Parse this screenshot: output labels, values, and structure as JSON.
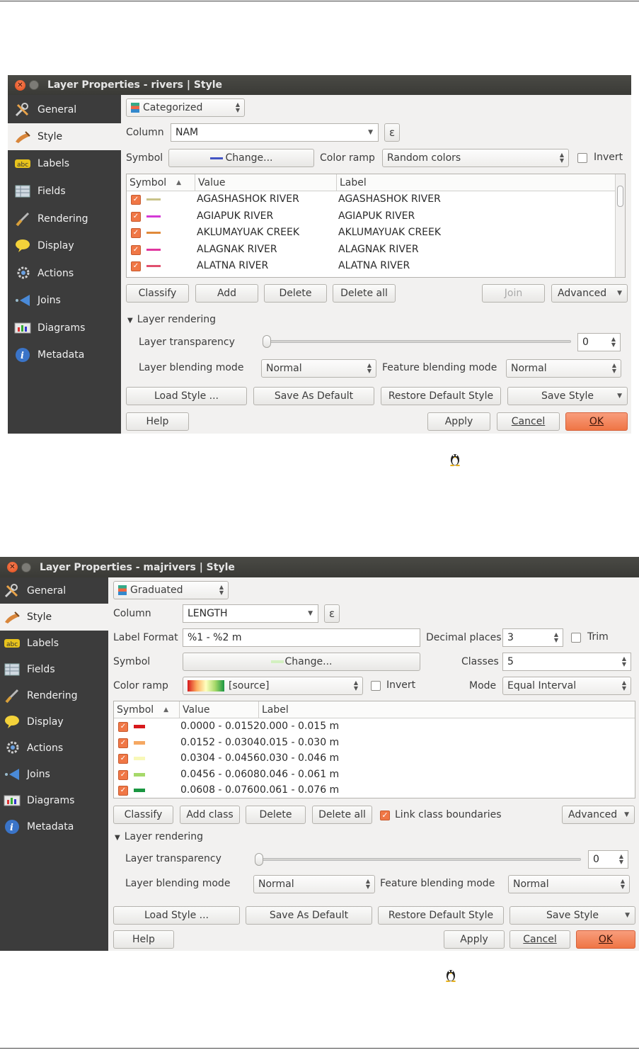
{
  "dialog1": {
    "title": "Layer Properties - rivers | Style",
    "sidebar": [
      "General",
      "Style",
      "Labels",
      "Fields",
      "Rendering",
      "Display",
      "Actions",
      "Joins",
      "Diagrams",
      "Metadata"
    ],
    "renderer": "Categorized",
    "column_label": "Column",
    "column_value": "NAM",
    "symbol_label": "Symbol",
    "change_label": "Change...",
    "color_ramp_label": "Color ramp",
    "color_ramp_value": "Random colors",
    "invert_label": "Invert",
    "headers": [
      "Symbol",
      "Value",
      "Label"
    ],
    "rows": [
      {
        "value": "AGASHASHOK RIVER",
        "label": "AGASHASHOK RIVER",
        "color": "#c9c38a"
      },
      {
        "value": "AGIAPUK RIVER",
        "label": "AGIAPUK RIVER",
        "color": "#d33ad6"
      },
      {
        "value": "AKLUMAYUAK CREEK",
        "label": "AKLUMAYUAK CREEK",
        "color": "#e08a3a"
      },
      {
        "value": "ALAGNAK RIVER",
        "label": "ALAGNAK RIVER",
        "color": "#e0379e"
      },
      {
        "value": "ALATNA RIVER",
        "label": "ALATNA RIVER",
        "color": "#e0506e"
      }
    ],
    "buttons": {
      "classify": "Classify",
      "add": "Add",
      "delete": "Delete",
      "delete_all": "Delete all",
      "join": "Join",
      "advanced": "Advanced"
    },
    "layer_rendering": "Layer rendering",
    "transparency_label": "Layer transparency",
    "transparency_value": "0",
    "blending_label": "Layer blending mode",
    "blending_value": "Normal",
    "feature_blending_label": "Feature blending mode",
    "feature_blending_value": "Normal",
    "style_buttons": {
      "load": "Load Style ...",
      "save_default": "Save As Default",
      "restore": "Restore Default Style",
      "save": "Save Style"
    },
    "footer": {
      "help": "Help",
      "apply": "Apply",
      "cancel": "Cancel",
      "ok": "OK"
    }
  },
  "dialog2": {
    "title": "Layer Properties - majrivers | Style",
    "sidebar": [
      "General",
      "Style",
      "Labels",
      "Fields",
      "Rendering",
      "Display",
      "Actions",
      "Joins",
      "Diagrams",
      "Metadata"
    ],
    "renderer": "Graduated",
    "column_label": "Column",
    "column_value": "LENGTH",
    "label_format_label": "Label Format",
    "label_format_value": "%1 - %2 m",
    "decimal_places_label": "Decimal places",
    "decimal_places_value": "3",
    "trim_label": "Trim",
    "symbol_label": "Symbol",
    "change_label": "Change...",
    "classes_label": "Classes",
    "classes_value": "5",
    "color_ramp_label": "Color ramp",
    "color_ramp_value": "[source]",
    "invert_label": "Invert",
    "mode_label": "Mode",
    "mode_value": "Equal Interval",
    "headers": [
      "Symbol",
      "Value",
      "Label"
    ],
    "rows": [
      {
        "value": "0.0000 - 0.0152",
        "label": "0.000 - 0.015 m",
        "color": "#d7191c"
      },
      {
        "value": "0.0152 - 0.0304",
        "label": "0.015 - 0.030 m",
        "color": "#f5a862"
      },
      {
        "value": "0.0304 - 0.0456",
        "label": "0.030 - 0.046 m",
        "color": "#f8f8b8"
      },
      {
        "value": "0.0456 - 0.0608",
        "label": "0.046 - 0.061 m",
        "color": "#a6d96a"
      },
      {
        "value": "0.0608 - 0.0760",
        "label": "0.061 - 0.076 m",
        "color": "#1a9641"
      }
    ],
    "buttons": {
      "classify": "Classify",
      "add_class": "Add class",
      "delete": "Delete",
      "delete_all": "Delete all",
      "link_boundaries": "Link class boundaries",
      "advanced": "Advanced"
    },
    "layer_rendering": "Layer rendering",
    "transparency_label": "Layer transparency",
    "transparency_value": "0",
    "blending_label": "Layer blending mode",
    "blending_value": "Normal",
    "feature_blending_label": "Feature blending mode",
    "feature_blending_value": "Normal",
    "style_buttons": {
      "load": "Load Style ...",
      "save_default": "Save As Default",
      "restore": "Restore Default Style",
      "save": "Save Style"
    },
    "footer": {
      "help": "Help",
      "apply": "Apply",
      "cancel": "Cancel",
      "ok": "OK"
    }
  },
  "icons": [
    "close-icon",
    "minimize-icon",
    "tools-icon",
    "brush-icon",
    "abc-icon",
    "table-icon",
    "paintbrush-icon",
    "speech-bubble-icon",
    "gear-icon",
    "arrow-left-icon",
    "chart-icon",
    "info-icon",
    "epsilon-icon",
    "tux-icon"
  ]
}
